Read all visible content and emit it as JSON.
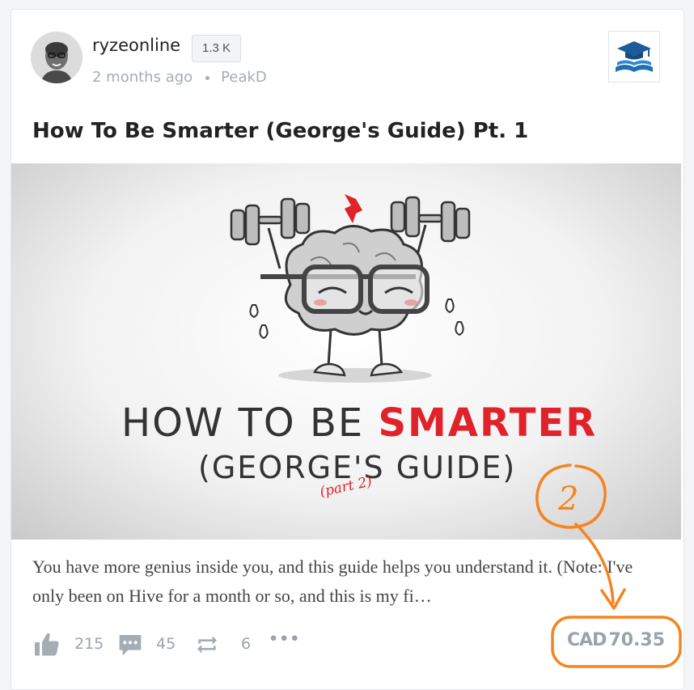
{
  "post": {
    "author": "ryzeonline",
    "reputation": "1.3 K",
    "time": "2 months ago",
    "app": "PeakD",
    "title": "How To Be Smarter (George's Guide) Pt. 1",
    "excerpt": "You have more genius inside you, and this guide helps you understand it. (Note: I've only been on Hive for a month or so, and this is my fi…",
    "image_text": {
      "line1_prefix": "HOW TO BE ",
      "line1_highlight": "SMARTER",
      "line2": "(GEORGE'S GUIDE)",
      "line3": "(part 2)"
    }
  },
  "actions": {
    "likes": "215",
    "comments": "45",
    "reblogs": "6",
    "more": "•••"
  },
  "payout": {
    "currency": "CAD",
    "amount": "70.35"
  },
  "annotation": {
    "label": "2",
    "color": "#f5841f"
  },
  "icons": {
    "like": "thumbs-up-icon",
    "comment": "comment-icon",
    "reblog": "reblog-icon",
    "more": "more-icon",
    "community": "graduation-book-icon"
  }
}
